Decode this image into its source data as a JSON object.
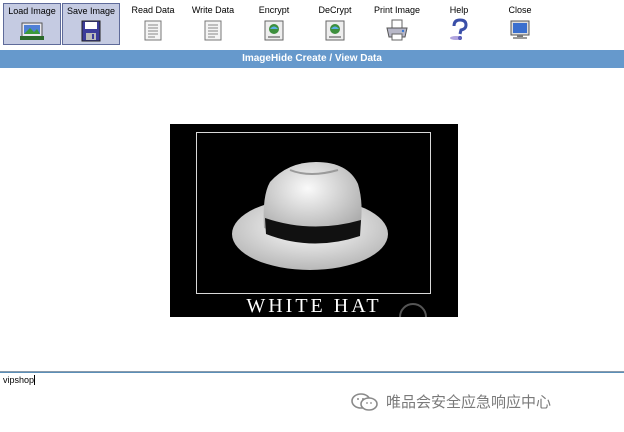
{
  "toolbar": {
    "buttons": [
      {
        "label": "Load Image",
        "icon": "load-image-icon"
      },
      {
        "label": "Save Image",
        "icon": "save-image-icon"
      },
      {
        "label": "Read Data",
        "icon": "read-data-icon"
      },
      {
        "label": "Write Data",
        "icon": "write-data-icon"
      },
      {
        "label": "Encrypt",
        "icon": "encrypt-icon"
      },
      {
        "label": "DeCrypt",
        "icon": "decrypt-icon"
      },
      {
        "label": "Print Image",
        "icon": "printer-icon"
      },
      {
        "label": "Help",
        "icon": "help-icon"
      },
      {
        "label": "Close",
        "icon": "monitor-icon"
      }
    ]
  },
  "title_bar": {
    "text": "ImageHide Create / View Data"
  },
  "image": {
    "caption": "WHITE HAT"
  },
  "data_field": {
    "value": "vipshop"
  },
  "watermark": {
    "text": "唯品会安全应急响应中心",
    "icon": "wechat-icon"
  },
  "colors": {
    "title_bar": "#6699cc",
    "pressed_button": "#c5cbe2"
  }
}
